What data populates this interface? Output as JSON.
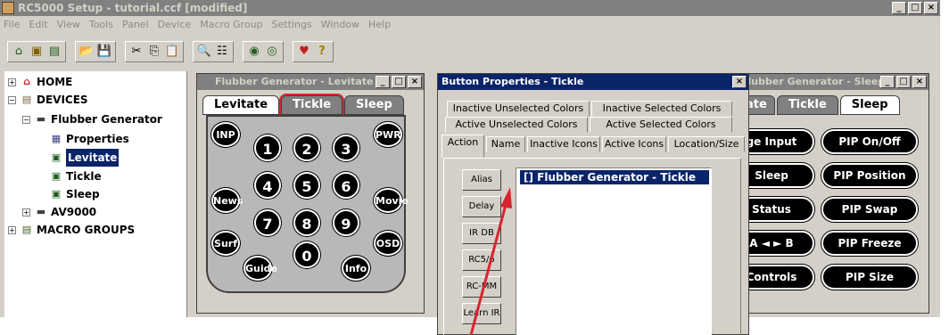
{
  "app": {
    "title": "RC5000 Setup - tutorial.ccf [modified]"
  },
  "window_controls": {
    "minimize": "_",
    "maximize": "□",
    "close": "×"
  },
  "menu": [
    "File",
    "Edit",
    "View",
    "Tools",
    "Panel",
    "Device",
    "Macro Group",
    "Settings",
    "Window",
    "Help"
  ],
  "toolbar": {
    "groups": [
      [
        {
          "icon": "house-icon",
          "glyph": "⌂"
        },
        {
          "icon": "device-icon",
          "glyph": "▣"
        },
        {
          "icon": "macro-icon",
          "glyph": "▤"
        }
      ],
      [
        {
          "icon": "open-folder-icon",
          "glyph": "📂"
        },
        {
          "icon": "save-icon",
          "glyph": "💾"
        }
      ],
      [
        {
          "icon": "cut-icon",
          "glyph": "✂"
        },
        {
          "icon": "copy-icon",
          "glyph": "⎘"
        },
        {
          "icon": "paste-icon",
          "glyph": "📋"
        }
      ],
      [
        {
          "icon": "find-icon",
          "glyph": "🔍"
        },
        {
          "icon": "properties-icon",
          "glyph": "☷"
        }
      ],
      [
        {
          "icon": "send-icon",
          "glyph": "◉"
        },
        {
          "icon": "receive-icon",
          "glyph": "◎"
        }
      ],
      [
        {
          "icon": "emulate-icon",
          "glyph": "♥"
        },
        {
          "icon": "help-icon",
          "glyph": "?"
        }
      ]
    ]
  },
  "tree": {
    "expand_symbol": "+",
    "collapse_symbol": "−",
    "items": [
      {
        "label": "HOME",
        "icon": "home-icon"
      },
      {
        "label": "DEVICES",
        "icon": "devices-folder-icon"
      },
      {
        "label": "Flubber Generator",
        "icon": "device-icon"
      },
      {
        "label": "Properties",
        "icon": "properties-icon"
      },
      {
        "label": "Levitate",
        "icon": "panel-icon",
        "selected": true
      },
      {
        "label": "Tickle",
        "icon": "panel-icon"
      },
      {
        "label": "Sleep",
        "icon": "panel-icon"
      },
      {
        "label": "AV9000",
        "icon": "device-icon"
      },
      {
        "label": "MACRO GROUPS",
        "icon": "macro-groups-icon"
      }
    ]
  },
  "levitate_window": {
    "title": "Flubber Generator - Levitate",
    "tabs": [
      "Levitate",
      "Tickle",
      "Sleep"
    ],
    "side_buttons": [
      "INP",
      "PWR",
      "News",
      "Movie",
      "Surf",
      "OSD",
      "Guide",
      "Info"
    ],
    "digits": [
      "1",
      "2",
      "3",
      "4",
      "5",
      "6",
      "7",
      "8",
      "9",
      "0"
    ]
  },
  "dialog": {
    "title": "Button Properties - Tickle",
    "close": "×",
    "tabs_row1": [
      "Inactive Unselected Colors",
      "Inactive Selected Colors"
    ],
    "tabs_row2": [
      "Active Unselected Colors",
      "Active Selected Colors"
    ],
    "tabs_row3": [
      "Action",
      "Name",
      "Inactive Icons",
      "Active Icons",
      "Location/Size"
    ],
    "side_buttons": [
      "Alias",
      "Delay",
      "IR DB",
      "RC5/6",
      "RC-MM",
      "Learn IR"
    ],
    "action_item": "[] Flubber Generator - Tickle"
  },
  "sleep_window": {
    "title": "Flubber Generator - Sleep",
    "tabs": [
      "Tickle",
      "Sleep"
    ],
    "tab_fragment": "ate",
    "left_buttons": [
      "ge Input",
      "Sleep",
      "Status",
      "A ◄ ► B",
      "Controls"
    ],
    "right_buttons": [
      "PIP On/Off",
      "PIP Position",
      "PIP Swap",
      "PIP Freeze",
      "PIP Size"
    ]
  },
  "colors": {
    "accent_red": "#d8242e",
    "selection": "#0a246a",
    "face": "#d4d0c8"
  }
}
